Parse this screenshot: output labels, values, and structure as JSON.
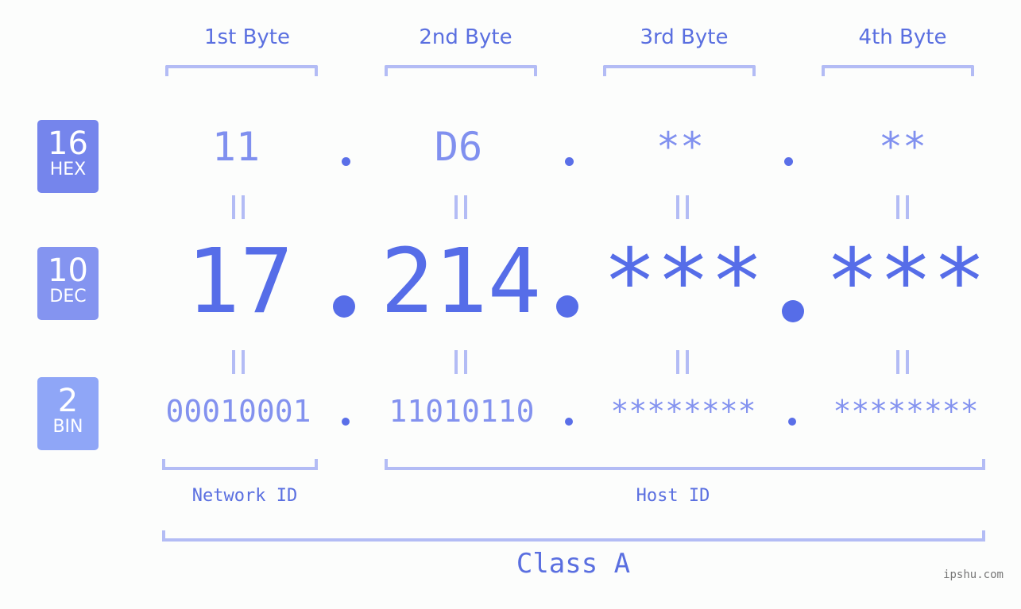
{
  "headers": [
    "1st Byte",
    "2nd Byte",
    "3rd Byte",
    "4th Byte"
  ],
  "badges": {
    "hex": {
      "num": "16",
      "label": "HEX",
      "color": "#7585ec"
    },
    "dec": {
      "num": "10",
      "label": "DEC",
      "color": "#8494f0"
    },
    "bin": {
      "num": "2",
      "label": "BIN",
      "color": "#8fa6f7"
    }
  },
  "hex": [
    "11",
    "D6",
    "**",
    "**"
  ],
  "dec": [
    "17",
    "214",
    "***",
    "***"
  ],
  "bin": [
    "00010001",
    "11010110",
    "********",
    "********"
  ],
  "labels": {
    "network": "Network ID",
    "host": "Host ID",
    "class": "Class A"
  },
  "watermark": "ipshu.com",
  "colors": {
    "accent": "#566de8",
    "bracket": "#b3bcf5"
  }
}
